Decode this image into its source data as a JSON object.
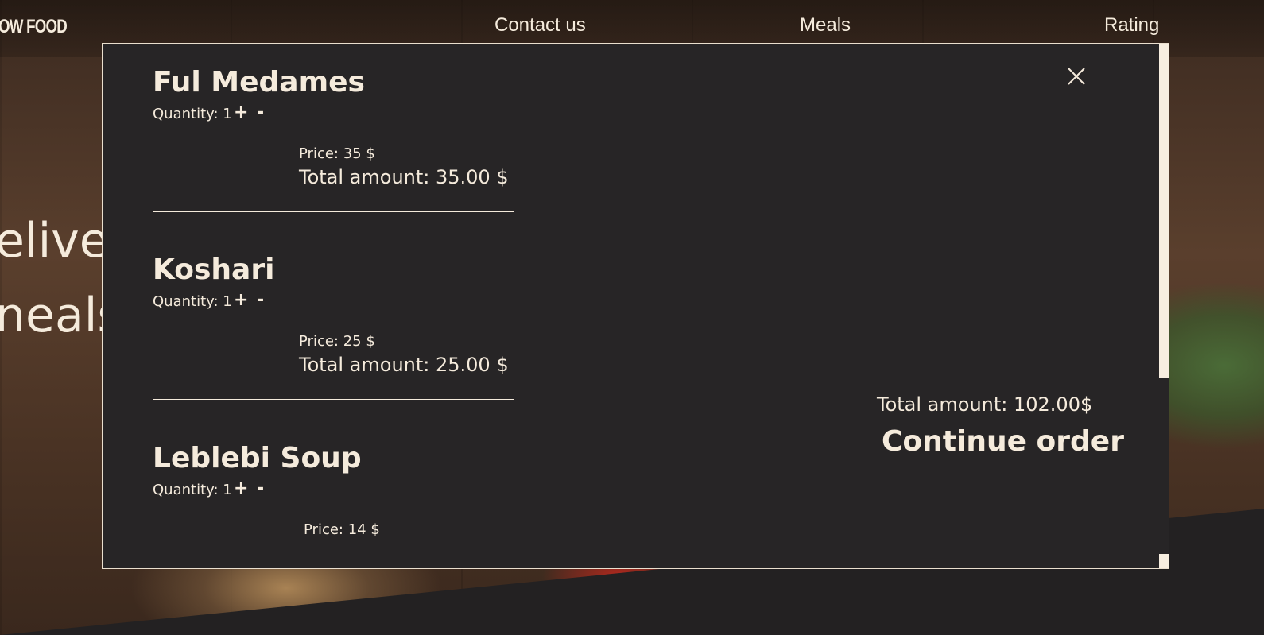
{
  "nav": {
    "logo": "OW FOOD",
    "links": [
      "Contact us",
      "Meals",
      "Rating"
    ]
  },
  "hero": {
    "line1": "elive",
    "line2": "neals"
  },
  "cart": {
    "close_icon": "close-icon",
    "quantity_label": "Quantity:",
    "plus_label": "+",
    "minus_label": "-",
    "items": [
      {
        "name": "Ful Medames",
        "quantity_text": "Quantity: 1",
        "price_text": "Price: 35 $",
        "total_text": "Total amount: 35.00 $"
      },
      {
        "name": "Koshari",
        "quantity_text": "Quantity: 1",
        "price_text": "Price: 25 $",
        "total_text": "Total amount: 25.00 $"
      },
      {
        "name": "Leblebi Soup",
        "quantity_text": "Quantity: 1",
        "price_text": "Price: 14 $"
      }
    ],
    "summary_total": "Total amount: 102.00$",
    "continue_label": "Continue order"
  },
  "colors": {
    "background": "#232122",
    "modal": "#272526",
    "text": "#f5ebdc"
  }
}
